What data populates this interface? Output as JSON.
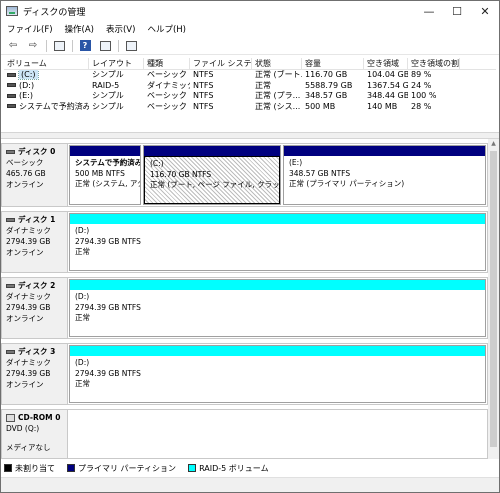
{
  "window": {
    "title": "ディスクの管理",
    "minimize": "—",
    "maximize": "☐",
    "close": "✕"
  },
  "menu": [
    "ファイル(F)",
    "操作(A)",
    "表示(V)",
    "ヘルプ(H)"
  ],
  "toolbar": {
    "back": "⇦",
    "forward": "⇨",
    "help": "?"
  },
  "volume_table": {
    "columns": [
      "ボリューム",
      "レイアウト",
      "種類",
      "ファイル システム",
      "状態",
      "容量",
      "空き領域",
      "空き領域の割..."
    ],
    "rows": [
      [
        "(C:)",
        "シンプル",
        "ベーシック",
        "NTFS",
        "正常 (ブート...",
        "116.70 GB",
        "104.04 GB",
        "89 %"
      ],
      [
        "(D:)",
        "RAID-5",
        "ダイナミック",
        "NTFS",
        "正常",
        "5588.79 GB",
        "1367.54 GB",
        "24 %"
      ],
      [
        "(E:)",
        "シンプル",
        "ベーシック",
        "NTFS",
        "正常 (プラ...",
        "348.57 GB",
        "348.44 GB",
        "100 %"
      ],
      [
        "システムで予約済み",
        "シンプル",
        "ベーシック",
        "NTFS",
        "正常 (シス...",
        "500 MB",
        "140 MB",
        "28 %"
      ]
    ]
  },
  "disks": [
    {
      "name": "ディスク 0",
      "type": "ベーシック",
      "size": "465.76 GB",
      "status": "オンライン",
      "partitions": [
        {
          "label": "システムで予約済み",
          "size": "500 MB NTFS",
          "status": "正常 (システム, アク",
          "style": "primary"
        },
        {
          "label": "(C:)",
          "size": "116.70 GB NTFS",
          "status": "正常 (ブート, ページ ファイル, クラッシュ ダ",
          "style": "primary-selected"
        },
        {
          "label": "(E:)",
          "size": "348.57 GB NTFS",
          "status": "正常 (プライマリ パーティション)",
          "style": "primary"
        }
      ]
    },
    {
      "name": "ディスク 1",
      "type": "ダイナミック",
      "size": "2794.39 GB",
      "status": "オンライン",
      "partitions": [
        {
          "label": "(D:)",
          "size": "2794.39 GB NTFS",
          "status": "正常",
          "style": "raid"
        }
      ]
    },
    {
      "name": "ディスク 2",
      "type": "ダイナミック",
      "size": "2794.39 GB",
      "status": "オンライン",
      "partitions": [
        {
          "label": "(D:)",
          "size": "2794.39 GB NTFS",
          "status": "正常",
          "style": "raid"
        }
      ]
    },
    {
      "name": "ディスク 3",
      "type": "ダイナミック",
      "size": "2794.39 GB",
      "status": "オンライン",
      "partitions": [
        {
          "label": "(D:)",
          "size": "2794.39 GB NTFS",
          "status": "正常",
          "style": "raid"
        }
      ]
    }
  ],
  "cdrom": {
    "name": "CD-ROM 0",
    "drive": "DVD (Q:)",
    "status": "メディアなし"
  },
  "legend": [
    {
      "label": "未割り当て",
      "color": "#000000"
    },
    {
      "label": "プライマリ パーティション",
      "color": "#00007f"
    },
    {
      "label": "RAID-5 ボリューム",
      "color": "#00ffff"
    }
  ]
}
